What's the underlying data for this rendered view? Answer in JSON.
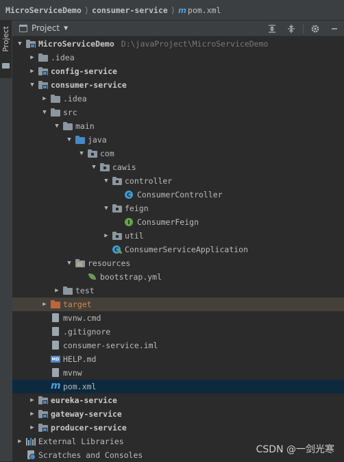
{
  "breadcrumb": {
    "items": [
      "MicroServiceDemo",
      "consumer-service",
      "pom.xml"
    ],
    "separator": "⟩"
  },
  "sidebar": {
    "tab_label": "Project"
  },
  "panel": {
    "title": "Project",
    "tools": [
      "collapse-all",
      "expand-all",
      "settings",
      "minimize"
    ]
  },
  "tree": {
    "rows": [
      {
        "label": "MicroServiceDemo",
        "suffix": "D:\\javaProject\\MicroServiceDemo",
        "depth": 0,
        "arrow": "down",
        "icon": "module-folder",
        "bold": true
      },
      {
        "label": ".idea",
        "depth": 1,
        "arrow": "right",
        "icon": "folder"
      },
      {
        "label": "config-service",
        "depth": 1,
        "arrow": "right",
        "icon": "module-folder",
        "bold": true
      },
      {
        "label": "consumer-service",
        "depth": 1,
        "arrow": "down",
        "icon": "module-folder",
        "bold": true
      },
      {
        "label": ".idea",
        "depth": 2,
        "arrow": "right",
        "icon": "folder"
      },
      {
        "label": "src",
        "depth": 2,
        "arrow": "down",
        "icon": "folder"
      },
      {
        "label": "main",
        "depth": 3,
        "arrow": "down",
        "icon": "folder"
      },
      {
        "label": "java",
        "depth": 4,
        "arrow": "down",
        "icon": "source-folder"
      },
      {
        "label": "com",
        "depth": 5,
        "arrow": "down",
        "icon": "package"
      },
      {
        "label": "cawis",
        "depth": 6,
        "arrow": "down",
        "icon": "package"
      },
      {
        "label": "controller",
        "depth": 7,
        "arrow": "down",
        "icon": "package"
      },
      {
        "label": "ConsumerController",
        "depth": 8,
        "arrow": "none",
        "icon": "class"
      },
      {
        "label": "feign",
        "depth": 7,
        "arrow": "down",
        "icon": "package"
      },
      {
        "label": "ConsumerFeign",
        "depth": 8,
        "arrow": "none",
        "icon": "interface"
      },
      {
        "label": "util",
        "depth": 7,
        "arrow": "right",
        "icon": "package"
      },
      {
        "label": "ConsumerServiceApplication",
        "depth": 7,
        "arrow": "none",
        "icon": "spring-class"
      },
      {
        "label": "resources",
        "depth": 4,
        "arrow": "down",
        "icon": "resources-folder"
      },
      {
        "label": "bootstrap.yml",
        "depth": 5,
        "arrow": "none",
        "icon": "spring-yml"
      },
      {
        "label": "test",
        "depth": 3,
        "arrow": "right",
        "icon": "folder"
      },
      {
        "label": "target",
        "depth": 2,
        "arrow": "right",
        "icon": "excluded-folder",
        "highlight": "target"
      },
      {
        "label": "mvnw.cmd",
        "depth": 2,
        "arrow": "none",
        "icon": "file"
      },
      {
        "label": ".gitignore",
        "depth": 2,
        "arrow": "none",
        "icon": "file"
      },
      {
        "label": "consumer-service.iml",
        "depth": 2,
        "arrow": "none",
        "icon": "file"
      },
      {
        "label": "HELP.md",
        "depth": 2,
        "arrow": "none",
        "icon": "md"
      },
      {
        "label": "mvnw",
        "depth": 2,
        "arrow": "none",
        "icon": "file"
      },
      {
        "label": "pom.xml",
        "depth": 2,
        "arrow": "none",
        "icon": "maven",
        "highlight": "selected"
      },
      {
        "label": "eureka-service",
        "depth": 1,
        "arrow": "right",
        "icon": "module-folder",
        "bold": true
      },
      {
        "label": "gateway-service",
        "depth": 1,
        "arrow": "right",
        "icon": "module-folder",
        "bold": true
      },
      {
        "label": "producer-service",
        "depth": 1,
        "arrow": "right",
        "icon": "module-folder",
        "bold": true
      },
      {
        "label": "External Libraries",
        "depth": 0,
        "arrow": "right",
        "icon": "libraries"
      },
      {
        "label": "Scratches and Consoles",
        "depth": 0,
        "arrow": "none",
        "icon": "scratches"
      }
    ]
  },
  "colors": {
    "folder": "#8c96a0",
    "source_folder": "#4a88c7",
    "excluded_folder": "#c0653a",
    "class_icon": "#3d9bd4",
    "interface_icon": "#62a644",
    "module_marker": "#4a88c7"
  },
  "watermark": "CSDN @一剑光寒"
}
